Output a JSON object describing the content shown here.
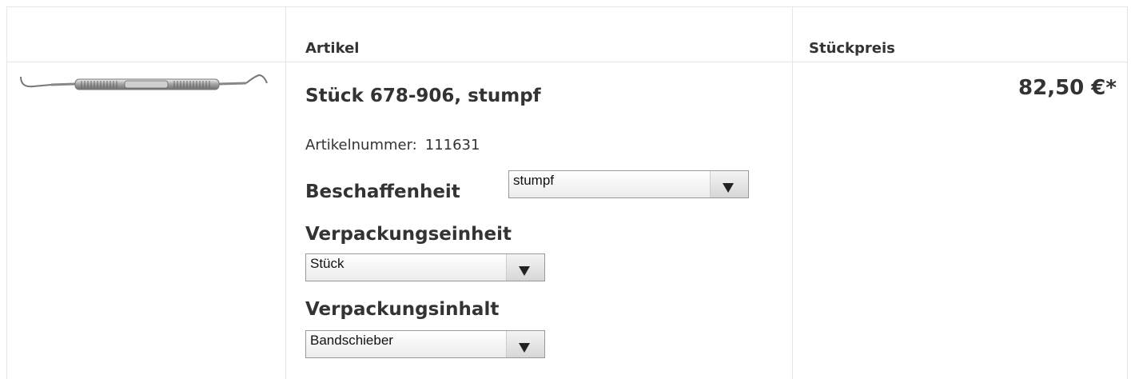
{
  "table": {
    "headers": {
      "image": "",
      "article": "Artikel",
      "unit_price": "Stückpreis"
    }
  },
  "product": {
    "image_icon": "dental-instrument-image",
    "title": "Stück 678-906, stumpf",
    "article_number_label": "Artikelnummer:",
    "article_number": "111631",
    "price": "82,50 €*",
    "attributes": [
      {
        "label": "Beschaffenheit",
        "selected": "stumpf"
      },
      {
        "label": "Verpackungseinheit",
        "selected": "Stück"
      },
      {
        "label": "Verpackungsinhalt",
        "selected": "Bandschieber"
      }
    ]
  },
  "colors": {
    "border": "#e6e6e6",
    "text": "#333333"
  }
}
